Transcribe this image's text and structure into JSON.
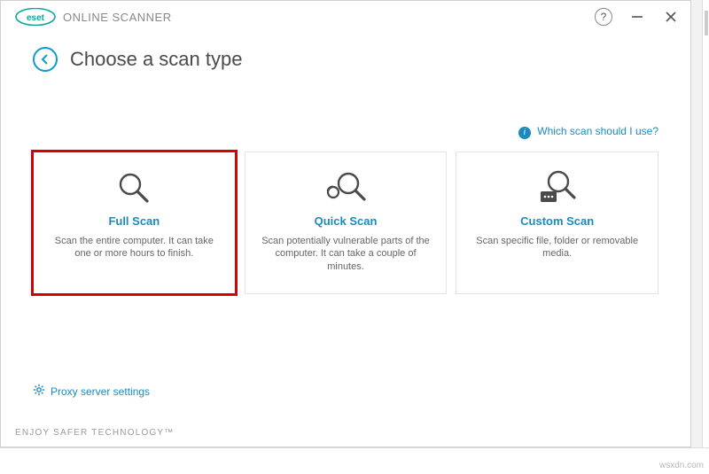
{
  "brand": {
    "name": "eset",
    "product": "ONLINE SCANNER"
  },
  "header": {
    "title": "Choose a scan type"
  },
  "helpLink": {
    "label": "Which scan should I use?"
  },
  "cards": {
    "full": {
      "title": "Full Scan",
      "desc": "Scan the entire computer. It can take one or more hours to finish."
    },
    "quick": {
      "title": "Quick Scan",
      "desc": "Scan potentially vulnerable parts of the computer. It can take a couple of minutes."
    },
    "custom": {
      "title": "Custom Scan",
      "desc": "Scan specific file, folder or removable media."
    }
  },
  "proxyLink": {
    "label": "Proxy server settings"
  },
  "footer": {
    "tagline": "ENJOY SAFER TECHNOLOGY™"
  },
  "watermark": "wsxdn.com"
}
